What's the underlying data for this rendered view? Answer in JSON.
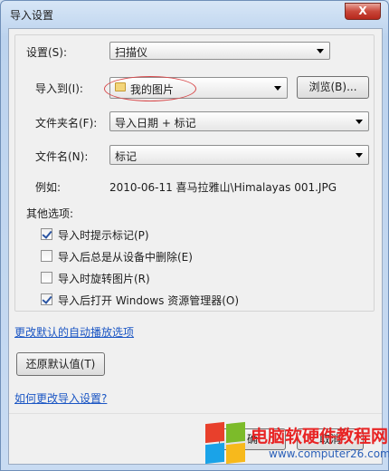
{
  "window": {
    "title": "导入设置",
    "close_label": "X"
  },
  "form": {
    "settings_label": "设置(S):",
    "settings_value": "扫描仪",
    "import_to_label": "导入到(I):",
    "import_to_value": "我的图片",
    "browse_label": "浏览(B)...",
    "folder_name_label": "文件夹名(F):",
    "folder_name_value": "导入日期 + 标记",
    "file_name_label": "文件名(N):",
    "file_name_value": "标记",
    "example_label": "例如:",
    "example_value": "2010-06-11 喜马拉雅山\\Himalayas 001.JPG",
    "other_options_label": "其他选项:"
  },
  "options": [
    {
      "label": "导入时提示标记(P)",
      "checked": true
    },
    {
      "label": "导入后总是从设备中删除(E)",
      "checked": false
    },
    {
      "label": "导入时旋转图片(R)",
      "checked": false
    },
    {
      "label": "导入后打开 Windows 资源管理器(O)",
      "checked": true
    }
  ],
  "links": {
    "autoplay": "更改默认的自动播放选项",
    "how_to": "如何更改导入设置?"
  },
  "buttons": {
    "restore_defaults": "还原默认值(T)",
    "ok_partial": "确",
    "cancel_partial": "取消"
  },
  "watermark": {
    "text": "电脑软硬件教程网",
    "url": "www.computer26.com",
    "colors": [
      "#e8402c",
      "#7cbb2a",
      "#1aa3e8",
      "#f7b91c"
    ]
  },
  "colors": {
    "link": "#1b56c4",
    "annotation_oval": "#d8484a"
  }
}
